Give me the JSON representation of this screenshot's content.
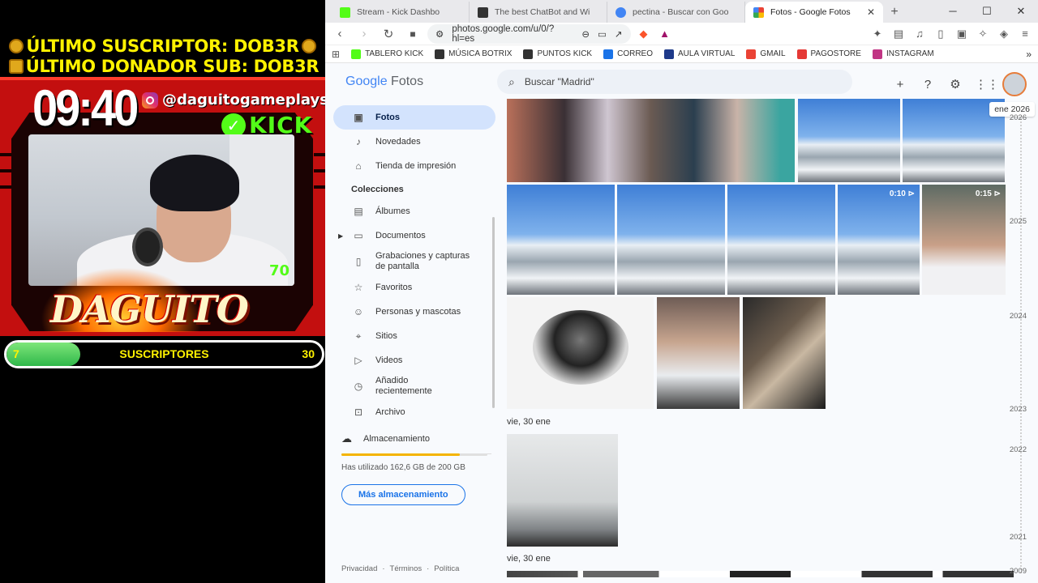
{
  "overlay": {
    "banner1": "ÚLTIMO SUSCRIPTOR: DOB3R",
    "banner2": "ÚLTIMO DONADOR SUB: DOB3R",
    "timer": "09:40",
    "instagram": "@daguitogameplays",
    "kick_label": "KICK",
    "name": "DAGUITO",
    "goal_label": "SUSCRIPTORES",
    "goal_current": "7",
    "goal_target": "30",
    "goal_progress": 0.233,
    "cam_badge": "70"
  },
  "browser": {
    "tabs": [
      {
        "title": "Stream - Kick Dashbo",
        "icon": "kick-icon",
        "color": "#53fc18"
      },
      {
        "title": "The best ChatBot and Wi",
        "icon": "botrix-icon",
        "color": "#333333"
      },
      {
        "title": "pectina - Buscar con Goo",
        "icon": "google-icon",
        "color": "#4285f4"
      },
      {
        "title": "Fotos - Google Fotos",
        "icon": "photos-icon",
        "color": "#ea4335"
      }
    ],
    "url": "photos.google.com/u/0/?hl=es",
    "bookmarks": [
      {
        "label": "TABLERO KICK",
        "color": "#53fc18"
      },
      {
        "label": "MÚSICA BOTRIX",
        "color": "#333333"
      },
      {
        "label": "PUNTOS KICK",
        "color": "#333333"
      },
      {
        "label": "CORREO",
        "color": "#1a73e8"
      },
      {
        "label": "AULA VIRTUAL",
        "color": "#1e3a8a"
      },
      {
        "label": "GMAIL",
        "color": "#ea4335"
      },
      {
        "label": "PAGOSTORE",
        "color": "#e53935"
      },
      {
        "label": "INSTAGRAM",
        "color": "#c13584"
      }
    ]
  },
  "photos": {
    "logo_google": "Google",
    "logo_fotos": "Fotos",
    "search_placeholder": "Buscar \"Madrid\"",
    "nav": [
      {
        "label": "Fotos",
        "icon": "photo-icon"
      },
      {
        "label": "Novedades",
        "icon": "bell-icon"
      },
      {
        "label": "Tienda de impresión",
        "icon": "store-icon"
      }
    ],
    "collections_label": "Colecciones",
    "collections": [
      {
        "label": "Álbumes",
        "icon": "album-icon"
      },
      {
        "label": "Documentos",
        "icon": "document-icon"
      },
      {
        "label": "Grabaciones y capturas de pantalla",
        "icon": "screenshot-icon"
      },
      {
        "label": "Favoritos",
        "icon": "star-icon"
      },
      {
        "label": "Personas y mascotas",
        "icon": "people-icon"
      },
      {
        "label": "Sitios",
        "icon": "pin-icon"
      },
      {
        "label": "Videos",
        "icon": "play-icon"
      },
      {
        "label": "Añadido recientemente",
        "icon": "clock-icon"
      },
      {
        "label": "Archivo",
        "icon": "archive-icon"
      }
    ],
    "storage_label": "Almacenamiento",
    "storage_used": "Has utilizado 162,6 GB de 200 GB",
    "storage_fraction": 0.813,
    "storage_button": "Más almacenamiento",
    "footer": [
      "Privacidad",
      "Términos",
      "Política"
    ],
    "date_labels": [
      "vie, 30 ene",
      "vie, 30 ene"
    ],
    "year_tag": "ene 2026",
    "years": [
      "2026",
      "2025",
      "2024",
      "2023",
      "2022",
      "2021",
      "2009"
    ],
    "video_durations": [
      "0:10",
      "0:15"
    ]
  }
}
